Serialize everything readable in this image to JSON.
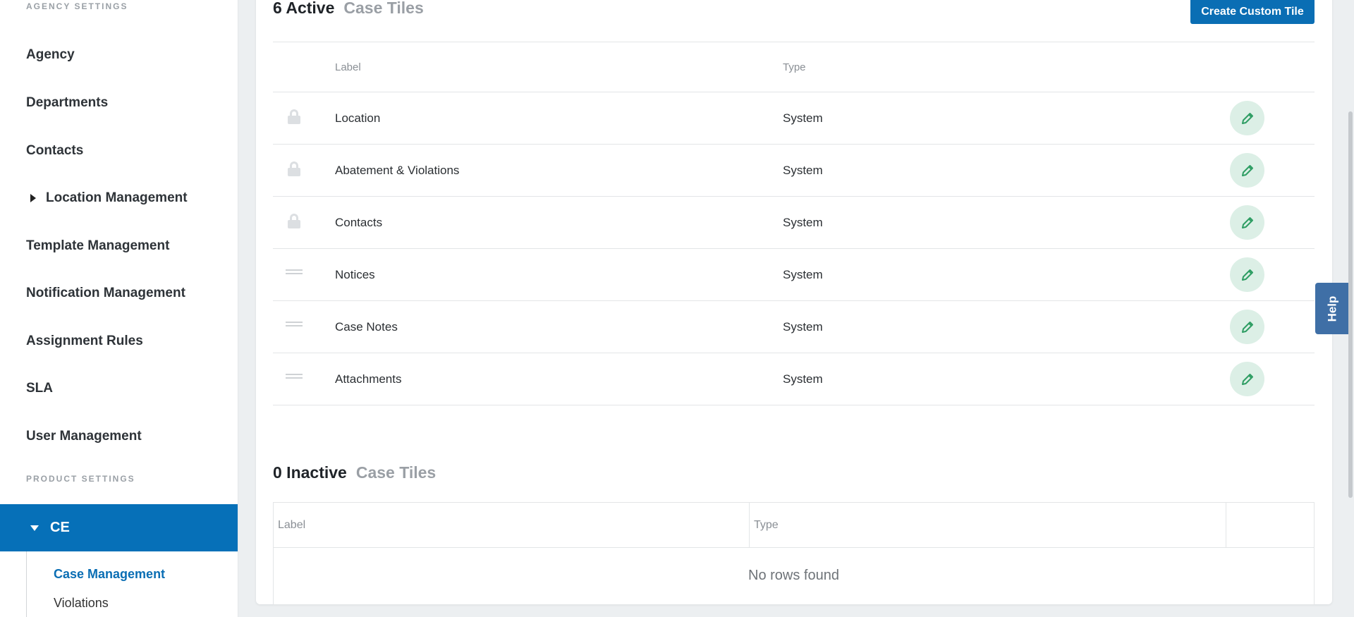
{
  "sidebar": {
    "agency_section_label": "AGENCY SETTINGS",
    "items": [
      {
        "label": "Agency"
      },
      {
        "label": "Departments"
      },
      {
        "label": "Contacts"
      },
      {
        "label": "Location Management"
      },
      {
        "label": "Template Management"
      },
      {
        "label": "Notification Management"
      },
      {
        "label": "Assignment Rules"
      },
      {
        "label": "SLA"
      },
      {
        "label": "User Management"
      }
    ],
    "product_section_label": "PRODUCT SETTINGS",
    "product": {
      "label": "CE",
      "expanded": true
    },
    "sub_items": [
      {
        "label": "Case Management",
        "active": true
      },
      {
        "label": "Violations",
        "active": false
      }
    ]
  },
  "active_section": {
    "count_label": "6 Active",
    "title": "Case Tiles",
    "create_button": "Create Custom Tile",
    "columns": {
      "label": "Label",
      "type": "Type"
    },
    "rows": [
      {
        "label": "Location",
        "type": "System",
        "icon": "lock-icon"
      },
      {
        "label": "Abatement & Violations",
        "type": "System",
        "icon": "lock-icon"
      },
      {
        "label": "Contacts",
        "type": "System",
        "icon": "lock-icon"
      },
      {
        "label": "Notices",
        "type": "System",
        "icon": "drag-handle-icon"
      },
      {
        "label": "Case Notes",
        "type": "System",
        "icon": "drag-handle-icon"
      },
      {
        "label": "Attachments",
        "type": "System",
        "icon": "drag-handle-icon"
      }
    ]
  },
  "inactive_section": {
    "count_label": "0 Inactive",
    "title": "Case Tiles",
    "columns": {
      "label": "Label",
      "type": "Type"
    },
    "empty_text": "No rows found"
  },
  "help": {
    "label": "Help"
  },
  "colors": {
    "primary": "#0a6eb4",
    "edit_bg": "#dcefe6",
    "edit_icon": "#2e9d63",
    "help_bg": "#3f6fa6"
  }
}
